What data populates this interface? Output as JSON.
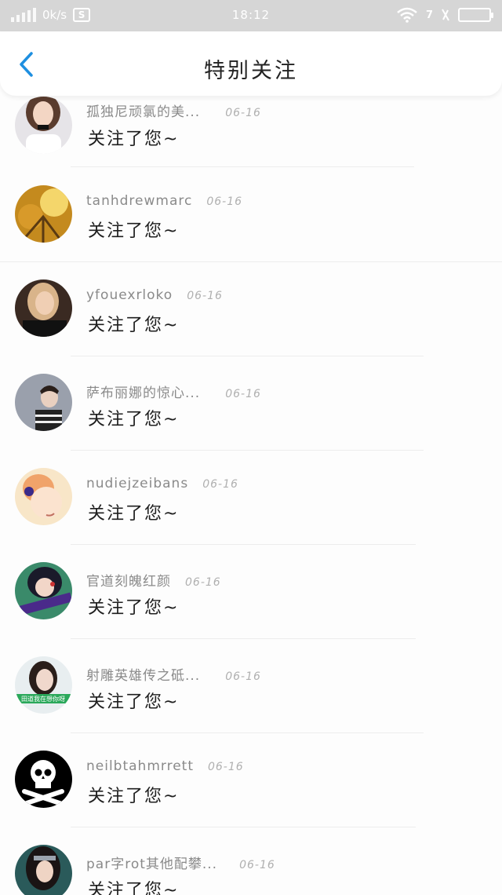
{
  "status_bar": {
    "speed": "0k/s",
    "sim_label": "S",
    "time": "18:12",
    "network": "7"
  },
  "header": {
    "title": "特别关注"
  },
  "items": [
    {
      "name": "孤独尼顽氯的美...",
      "date": "06-16",
      "message": "关注了您~"
    },
    {
      "name": "tanhdrewmarc",
      "date": "06-16",
      "message": "关注了您~"
    },
    {
      "name": "yfouexrloko",
      "date": "06-16",
      "message": "关注了您~"
    },
    {
      "name": "萨布丽娜的惊心...",
      "date": "06-16",
      "message": "关注了您~"
    },
    {
      "name": "nudiejzeibans",
      "date": "06-16",
      "message": "关注了您~"
    },
    {
      "name": "官道刻魄红颜",
      "date": "06-16",
      "message": "关注了您~"
    },
    {
      "name": "射雕英雄传之砥...",
      "date": "06-16",
      "message": "关注了您~"
    },
    {
      "name": "neilbtahmrrett",
      "date": "06-16",
      "message": "关注了您~"
    },
    {
      "name": "par字rot其他配攀...",
      "date": "06-16",
      "message": "关注了您~"
    }
  ],
  "avatar_text": "田道我在想你呀",
  "colors": {
    "accent": "#1e8fe0",
    "status_bar": "#d6d6d6",
    "name_text": "#8a8a8a",
    "date_text": "#b0b0b0"
  }
}
